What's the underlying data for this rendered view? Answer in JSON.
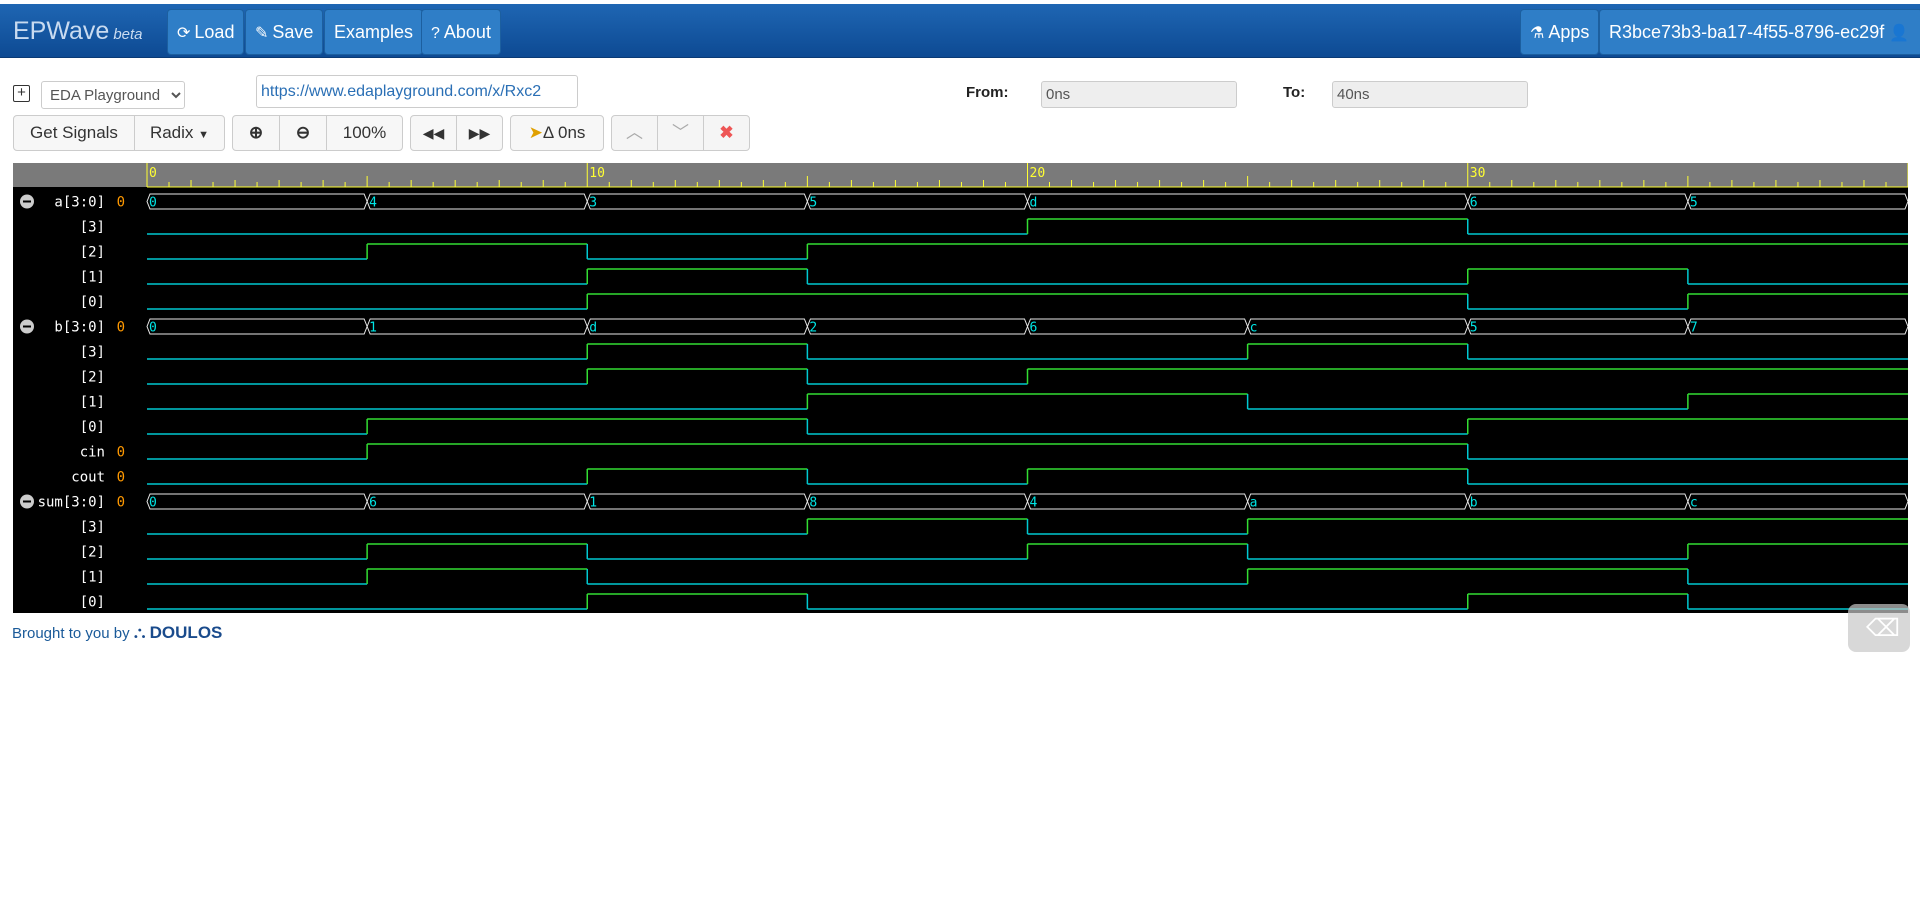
{
  "navbar": {
    "brand": "EPWave",
    "beta": "beta",
    "load": "Load",
    "save": "Save",
    "examples": "Examples",
    "about": "About",
    "apps": "Apps",
    "user": "R3bce73b3-ba17-4f55-8796-ec29f"
  },
  "toolbar": {
    "source_select": "EDA Playground",
    "url": "https://www.edaplayground.com/x/Rxc2",
    "from_label": "From:",
    "from_value": "0ns",
    "to_label": "To:",
    "to_value": "40ns",
    "get_signals": "Get Signals",
    "radix": "Radix",
    "zoom_level": "100%",
    "delta": "Δ 0ns"
  },
  "waveform": {
    "time_range": [
      0,
      40
    ],
    "ruler_labels": [
      "0",
      "10",
      "20",
      "30"
    ],
    "colors": {
      "value_text": "#00e5e5",
      "low": "#00c8d0",
      "high": "#33dd33",
      "bus": "#e8e8e8",
      "ruler": "#ffff33",
      "signal_name": "#ffffff",
      "signal_value": "#ff9900"
    },
    "signals": [
      {
        "name": "a[3:0]",
        "value": "0",
        "bus": true,
        "collapse": true,
        "changes": [
          [
            0,
            "0"
          ],
          [
            5,
            "4"
          ],
          [
            10,
            "3"
          ],
          [
            15,
            "5"
          ],
          [
            20,
            "d"
          ],
          [
            30,
            "6"
          ],
          [
            35,
            "5"
          ]
        ]
      },
      {
        "name": "[3]",
        "value": "",
        "bits": [
          [
            0,
            0
          ],
          [
            20,
            1
          ],
          [
            30,
            0
          ]
        ]
      },
      {
        "name": "[2]",
        "value": "",
        "bits": [
          [
            0,
            0
          ],
          [
            5,
            1
          ],
          [
            10,
            0
          ],
          [
            15,
            1
          ]
        ]
      },
      {
        "name": "[1]",
        "value": "",
        "bits": [
          [
            0,
            0
          ],
          [
            10,
            1
          ],
          [
            15,
            0
          ],
          [
            30,
            1
          ],
          [
            35,
            0
          ]
        ]
      },
      {
        "name": "[0]",
        "value": "",
        "bits": [
          [
            0,
            0
          ],
          [
            10,
            1
          ],
          [
            30,
            0
          ],
          [
            35,
            1
          ]
        ]
      },
      {
        "name": "b[3:0]",
        "value": "0",
        "bus": true,
        "collapse": true,
        "changes": [
          [
            0,
            "0"
          ],
          [
            5,
            "1"
          ],
          [
            10,
            "d"
          ],
          [
            15,
            "2"
          ],
          [
            20,
            "6"
          ],
          [
            25,
            "c"
          ],
          [
            30,
            "5"
          ],
          [
            35,
            "7"
          ]
        ]
      },
      {
        "name": "[3]",
        "value": "",
        "bits": [
          [
            0,
            0
          ],
          [
            10,
            1
          ],
          [
            15,
            0
          ],
          [
            25,
            1
          ],
          [
            30,
            0
          ]
        ]
      },
      {
        "name": "[2]",
        "value": "",
        "bits": [
          [
            0,
            0
          ],
          [
            10,
            1
          ],
          [
            15,
            0
          ],
          [
            20,
            1
          ]
        ]
      },
      {
        "name": "[1]",
        "value": "",
        "bits": [
          [
            0,
            0
          ],
          [
            15,
            1
          ],
          [
            25,
            0
          ],
          [
            35,
            1
          ]
        ]
      },
      {
        "name": "[0]",
        "value": "",
        "bits": [
          [
            0,
            0
          ],
          [
            5,
            1
          ],
          [
            15,
            0
          ],
          [
            30,
            1
          ]
        ]
      },
      {
        "name": "cin",
        "value": "0",
        "bits": [
          [
            0,
            0
          ],
          [
            5,
            1
          ],
          [
            30,
            0
          ]
        ]
      },
      {
        "name": "cout",
        "value": "0",
        "bits": [
          [
            0,
            0
          ],
          [
            10,
            1
          ],
          [
            15,
            0
          ],
          [
            20,
            1
          ],
          [
            30,
            0
          ]
        ]
      },
      {
        "name": "sum[3:0]",
        "value": "0",
        "bus": true,
        "collapse": true,
        "changes": [
          [
            0,
            "0"
          ],
          [
            5,
            "6"
          ],
          [
            10,
            "1"
          ],
          [
            15,
            "8"
          ],
          [
            20,
            "4"
          ],
          [
            25,
            "a"
          ],
          [
            30,
            "b"
          ],
          [
            35,
            "c"
          ]
        ]
      },
      {
        "name": "[3]",
        "value": "",
        "bits": [
          [
            0,
            0
          ],
          [
            15,
            1
          ],
          [
            20,
            0
          ],
          [
            25,
            1
          ]
        ]
      },
      {
        "name": "[2]",
        "value": "",
        "bits": [
          [
            0,
            0
          ],
          [
            5,
            1
          ],
          [
            10,
            0
          ],
          [
            20,
            1
          ],
          [
            25,
            0
          ],
          [
            35,
            1
          ]
        ]
      },
      {
        "name": "[1]",
        "value": "",
        "bits": [
          [
            0,
            0
          ],
          [
            5,
            1
          ],
          [
            10,
            0
          ],
          [
            25,
            1
          ],
          [
            35,
            0
          ]
        ]
      },
      {
        "name": "[0]",
        "value": "",
        "bits": [
          [
            0,
            0
          ],
          [
            10,
            1
          ],
          [
            15,
            0
          ],
          [
            30,
            1
          ],
          [
            35,
            0
          ]
        ]
      }
    ]
  },
  "footer": {
    "text": "Brought to you by",
    "brand": "DOULOS"
  }
}
